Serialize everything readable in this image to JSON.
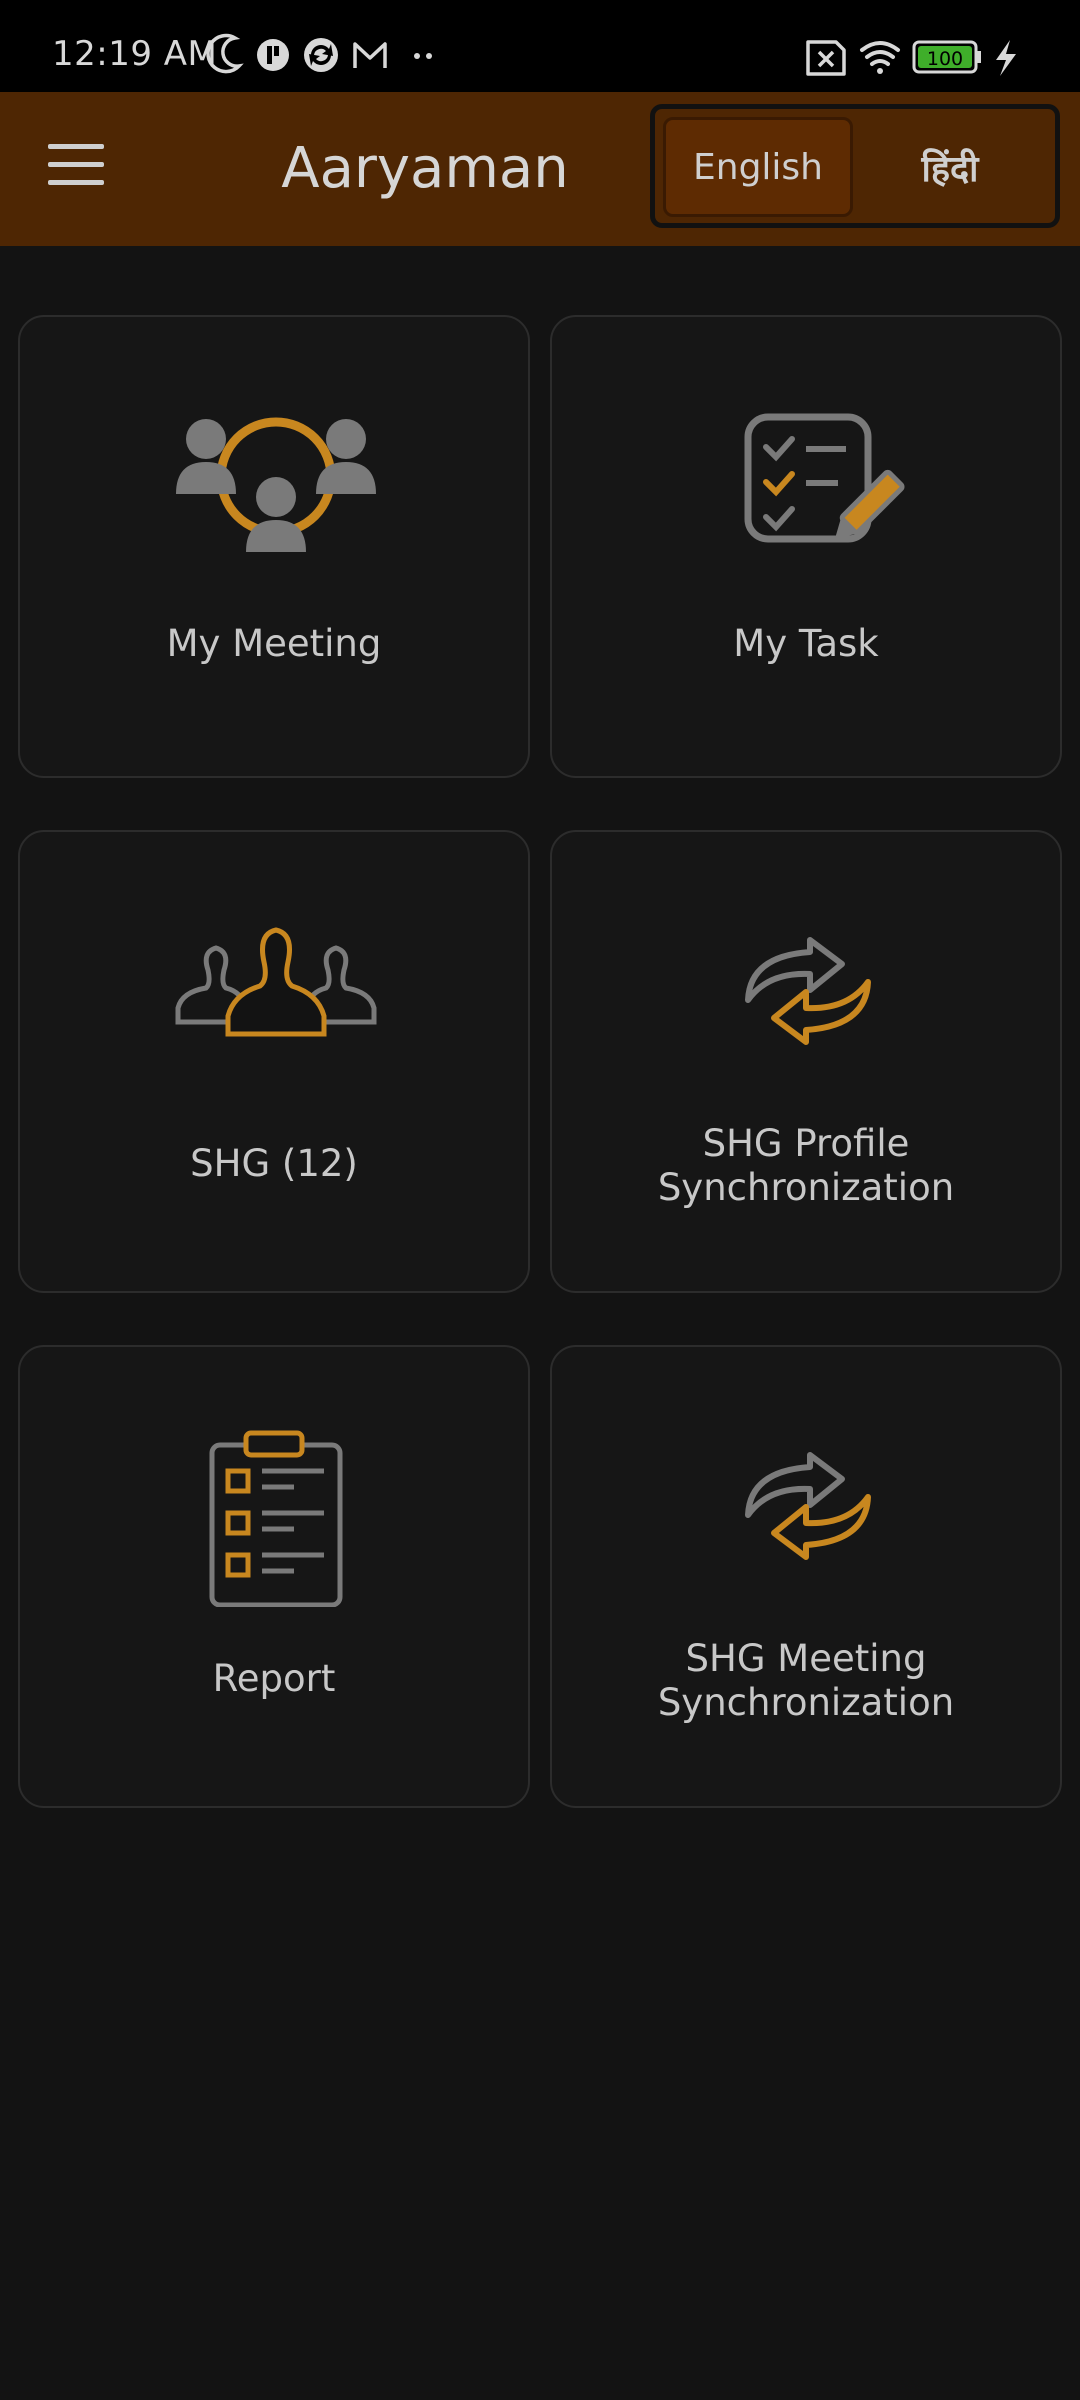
{
  "status_bar": {
    "time": "12:19 AM",
    "battery": "100",
    "icons": [
      "moon-icon",
      "app-icon",
      "sync-icon",
      "gmail-icon",
      "more-dots-icon",
      "no-sim-icon",
      "wifi-icon",
      "battery-icon",
      "charging-icon"
    ]
  },
  "app_bar": {
    "menu_icon": "hamburger-menu-icon",
    "title": "Aaryaman",
    "languages": [
      {
        "label": "English",
        "selected": true
      },
      {
        "label": "हिंदी",
        "selected": false
      }
    ]
  },
  "colors": {
    "app_bar": "#4e2603",
    "accent": "#c8871f",
    "icon_gray": "#7a7a7a",
    "background": "#131313"
  },
  "tiles": [
    {
      "label": "My Meeting",
      "icon": "meeting-group-icon"
    },
    {
      "label": "My Task",
      "icon": "task-checklist-icon"
    },
    {
      "label": "SHG (12)",
      "icon": "shg-group-icon"
    },
    {
      "label": "SHG Profile Synchronization",
      "icon": "sync-arrows-icon"
    },
    {
      "label": "Report",
      "icon": "report-clipboard-icon"
    },
    {
      "label": "SHG Meeting Synchronization",
      "icon": "sync-arrows-icon"
    }
  ]
}
